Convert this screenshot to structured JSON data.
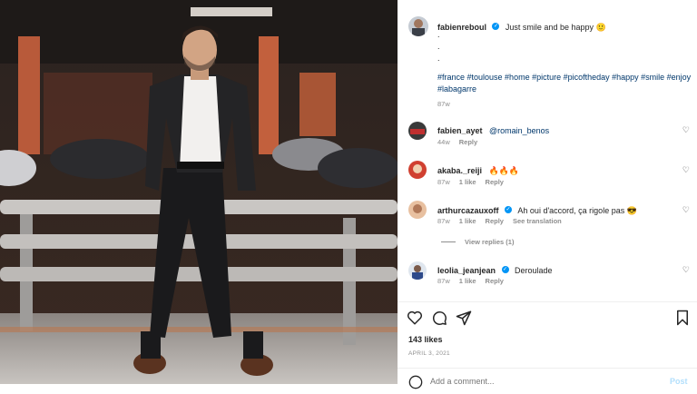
{
  "post": {
    "username": "fabienreboul",
    "caption": "Just smile and be happy 🙂",
    "dots": [
      ".",
      ".",
      "."
    ],
    "hashtags": "#france #toulouse #home #picture #picoftheday #happy #smile #enjoy #labagarre",
    "age": "87w",
    "likes": "143 likes",
    "date": "APRIL 3, 2021",
    "add_comment_placeholder": "Add a comment...",
    "post_button": "Post"
  },
  "comments": [
    {
      "user": "fabien_ayet",
      "verified": false,
      "text": "@romain_benos",
      "age": "44w",
      "likes": "",
      "reply": "Reply",
      "extra": ""
    },
    {
      "user": "akaba._reiji",
      "verified": false,
      "text": "🔥🔥🔥",
      "age": "87w",
      "likes": "1 like",
      "reply": "Reply",
      "extra": ""
    },
    {
      "user": "arthurcazauxoff",
      "verified": true,
      "text": "Ah oui d'accord, ça rigole pas 😎",
      "age": "87w",
      "likes": "1 like",
      "reply": "Reply",
      "extra": "See translation"
    },
    {
      "user": "leolia_jeanjean",
      "verified": true,
      "text": "Deroulade",
      "age": "87w",
      "likes": "1 like",
      "reply": "Reply",
      "extra": ""
    }
  ],
  "view_replies": "View replies (1)",
  "icons": {
    "like": "heart-icon",
    "comment": "comment-icon",
    "share": "share-icon",
    "save": "bookmark-icon",
    "verified": "verified-badge-icon"
  },
  "colors": {
    "link": "#00376b",
    "verified": "#0095f6",
    "muted": "#8e8e8e"
  }
}
